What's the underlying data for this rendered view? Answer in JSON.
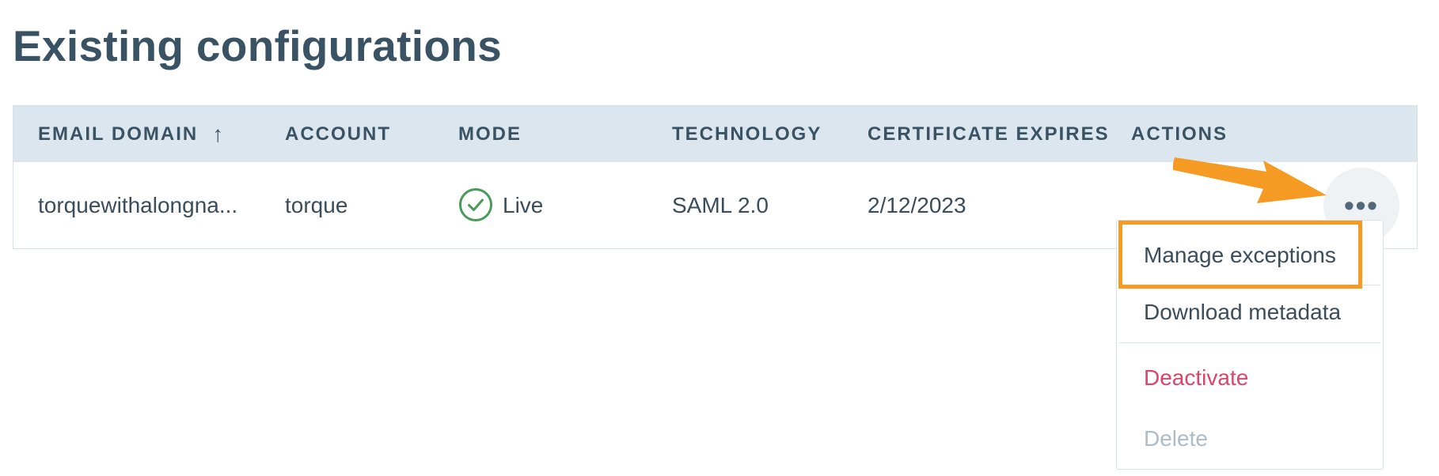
{
  "page": {
    "title": "Existing configurations"
  },
  "table": {
    "columns": [
      {
        "key": "email_domain",
        "label": "EMAIL DOMAIN",
        "sort": "↑"
      },
      {
        "key": "account",
        "label": "ACCOUNT"
      },
      {
        "key": "mode",
        "label": "MODE"
      },
      {
        "key": "technology",
        "label": "TECHNOLOGY"
      },
      {
        "key": "certificate_expires",
        "label": "CERTIFICATE EXPIRES"
      },
      {
        "key": "actions",
        "label": "ACTIONS"
      }
    ],
    "rows": [
      {
        "email_domain": "torquewithalongna...",
        "account": "torque",
        "mode": "Live",
        "mode_icon": "check-circle-icon",
        "technology": "SAML 2.0",
        "certificate_expires": "2/12/2023",
        "actions_icon": "more-horizontal-icon",
        "actions_glyph": "•••"
      }
    ]
  },
  "actions_menu": {
    "items": [
      {
        "label": "Manage exceptions",
        "state": "highlighted"
      },
      {
        "label": "Download metadata",
        "state": "normal"
      },
      {
        "label": "Deactivate",
        "state": "danger"
      },
      {
        "label": "Delete",
        "state": "disabled"
      }
    ]
  },
  "colors": {
    "title": "#3a5364",
    "header_bg": "#dce6ee",
    "live_green": "#4a9a5a",
    "danger": "#d9456b",
    "disabled": "#aebcc8",
    "annotation_orange": "#f59a23"
  }
}
